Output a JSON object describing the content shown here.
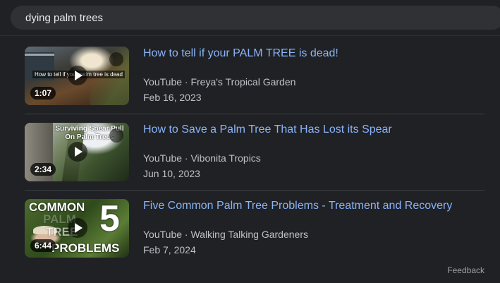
{
  "search": {
    "query": "dying palm trees"
  },
  "results": [
    {
      "title": "How to tell if your PALM TREE is dead!",
      "source": "YouTube · Freya's Tropical Garden",
      "date": "Feb 16, 2023",
      "duration": "1:07",
      "overlay_text": "How to tell if your palm tree is dead"
    },
    {
      "title": "How to Save a Palm Tree That Has Lost its Spear",
      "source": "YouTube · Vibonita Tropics",
      "date": "Jun 10, 2023",
      "duration": "2:34",
      "overlay_text": "Surviving Spear Pull On Palm Trees"
    },
    {
      "title": "Five Common Palm Tree Problems - Treatment and Recovery",
      "source": "YouTube · Walking Talking Gardeners",
      "date": "Feb 7, 2024",
      "duration": "6:44",
      "overlay_line1": "COMMON",
      "overlay_line2": "PALM",
      "overlay_line3": "TREE",
      "overlay_line4": "PROBLEMS",
      "overlay_number": "5"
    }
  ],
  "footer": {
    "feedback": "Feedback"
  },
  "colors": {
    "background": "#202124",
    "link": "#8ab4f8",
    "text": "#bdc1c6"
  }
}
